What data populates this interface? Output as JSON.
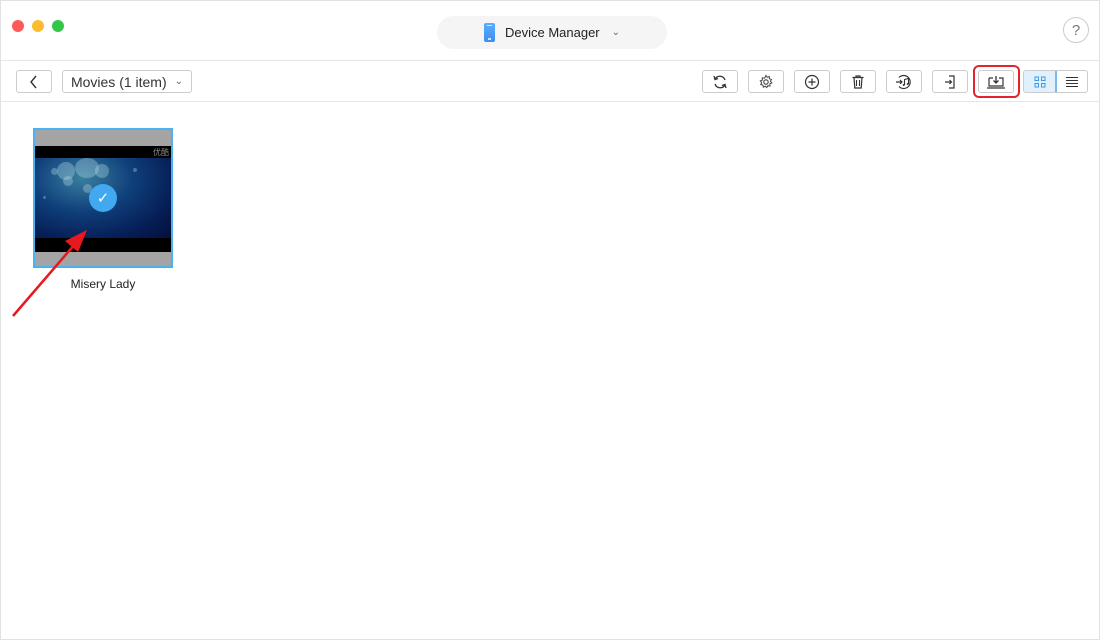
{
  "titlebar": {
    "device_name": "Device Manager",
    "help_label": "?"
  },
  "toolbar": {
    "back_label": "<",
    "category_label": "Movies (1 item)",
    "buttons": [
      {
        "name": "refresh-button",
        "icon": "refresh-icon"
      },
      {
        "name": "settings-button",
        "icon": "gear-icon"
      },
      {
        "name": "add-button",
        "icon": "plus-circle-icon"
      },
      {
        "name": "delete-button",
        "icon": "trash-icon"
      },
      {
        "name": "itunes-button",
        "icon": "music-import-icon"
      },
      {
        "name": "to-device-button",
        "icon": "import-to-device-icon"
      },
      {
        "name": "to-computer-button",
        "icon": "download-to-computer-icon",
        "highlighted": true
      }
    ],
    "view_mode": "grid"
  },
  "items": [
    {
      "name": "Misery Lady",
      "selected": true,
      "watermark": "优酷"
    }
  ],
  "colors": {
    "accent": "#42a8f0",
    "selection_border": "#4bb2f2",
    "highlight": "#e3242b"
  }
}
